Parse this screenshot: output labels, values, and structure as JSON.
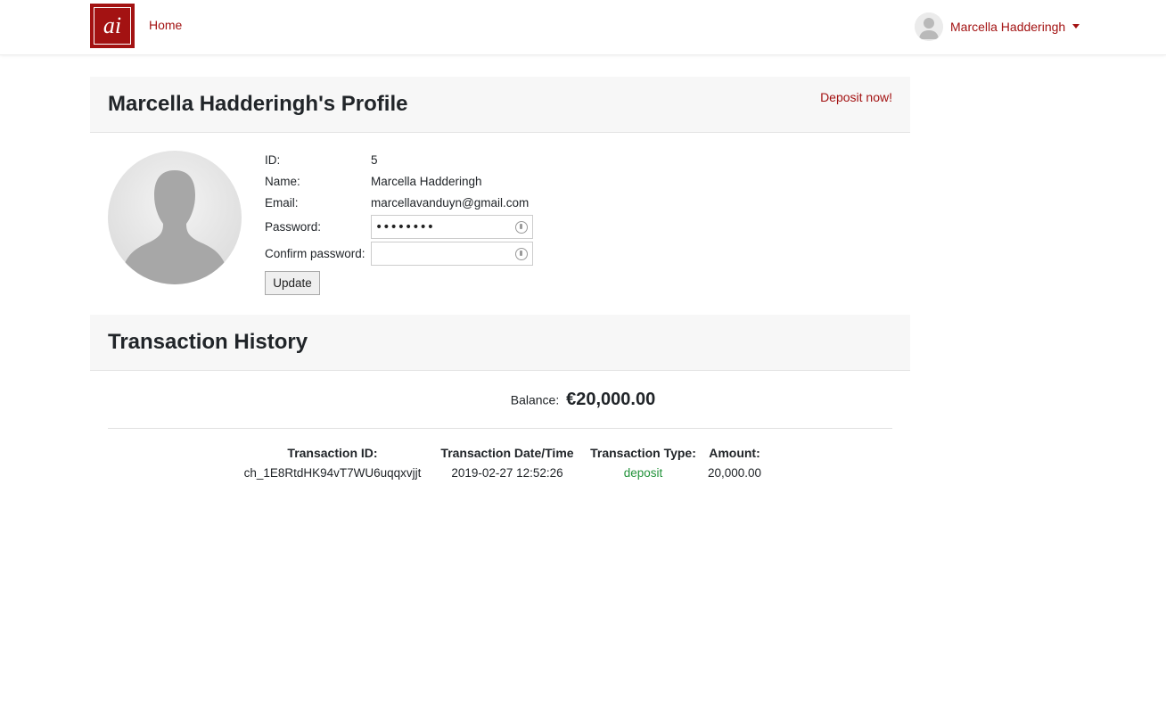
{
  "nav": {
    "logo_text": "ai",
    "home_label": "Home",
    "user_name": "Marcella Hadderingh"
  },
  "profile": {
    "title": "Marcella Hadderingh's Profile",
    "deposit_link": "Deposit now!",
    "fields": {
      "id_label": "ID:",
      "id_value": "5",
      "name_label": "Name:",
      "name_value": "Marcella Hadderingh",
      "email_label": "Email:",
      "email_value": "marcellavanduyn@gmail.com",
      "password_label": "Password:",
      "password_value": "••••••••",
      "confirm_label": "Confirm password:",
      "confirm_value": ""
    },
    "update_label": "Update"
  },
  "history": {
    "title": "Transaction History",
    "balance_label": "Balance:",
    "balance_value": "€20,000.00",
    "columns": [
      "Transaction ID:",
      "Transaction Date/Time",
      "Transaction Type:",
      "Amount:"
    ],
    "rows": [
      {
        "id": "ch_1E8RtdHK94vT7WU6uqqxvjjt",
        "datetime": "2019-02-27 12:52:26",
        "type": "deposit",
        "amount": "20,000.00"
      }
    ]
  },
  "colors": {
    "brand": "#a31212",
    "deposit": "#22923a",
    "header_bg": "#f7f7f7"
  },
  "icons": [
    "user-avatar-icon",
    "password-key-icon",
    "caret-down-icon"
  ]
}
